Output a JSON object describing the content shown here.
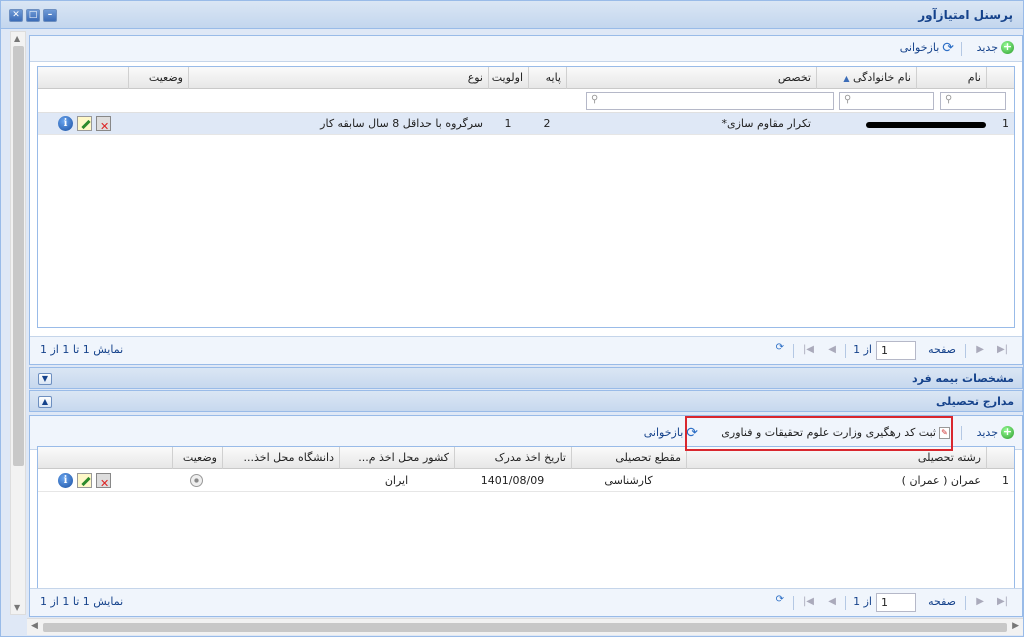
{
  "window": {
    "title": "پرسنل امتیازآور"
  },
  "toolbar1": {
    "new_label": "جدید",
    "reload_label": "بازخوانی"
  },
  "grid1": {
    "headers": [
      "نام",
      "نام خانوادگی",
      "تخصص",
      "پایه",
      "اولویت",
      "نوع",
      "وضعیت"
    ],
    "rows": [
      {
        "num": "1",
        "specialty": "تکرار مقاوم سازی*",
        "base": "2",
        "priority": "1",
        "type": "سرگروه با حداقل 8 سال سابقه کار"
      }
    ]
  },
  "pager1": {
    "page_label": "صفحه",
    "page_value": "1",
    "of_label": "از 1",
    "display_label": "نمایش 1 تا 1 از 1"
  },
  "section_insurance": {
    "title": "مشخصات بیمه فرد"
  },
  "section_education": {
    "title": "مدارج تحصیلی"
  },
  "toolbar2": {
    "new_label": "جدید",
    "track_label": "ثبت کد رهگیری وزارت علوم تحقیقات و فناوری",
    "reload_label": "بازخوانی"
  },
  "grid2": {
    "headers": [
      "رشته تحصیلی",
      "مقطع تحصیلی",
      "تاریخ اخذ مدرک",
      "کشور محل اخذ م...",
      "دانشگاه محل اخذ...",
      "وضعیت"
    ],
    "rows": [
      {
        "num": "1",
        "field": "عمران ( عمران )",
        "level": "کارشناسی",
        "date": "1401/08/09",
        "country": "ایران"
      }
    ]
  },
  "pager2": {
    "page_label": "صفحه",
    "page_value": "1",
    "of_label": "از 1",
    "display_label": "نمایش 1 تا 1 از 1"
  },
  "colors": {
    "accent": "#15428b",
    "highlight": "#d9272e",
    "header_bg": "#dae6f4"
  }
}
